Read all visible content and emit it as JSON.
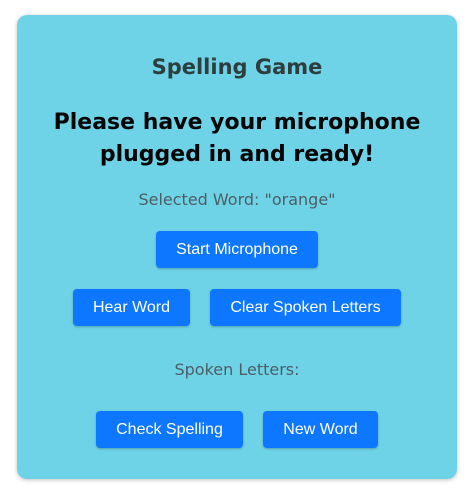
{
  "game": {
    "title": "Spelling Game",
    "instruction": "Please have your microphone plugged in and ready!",
    "selected_word_text": "Selected Word: \"orange\"",
    "spoken_letters_label": "Spoken Letters:"
  },
  "buttons": {
    "start_microphone": "Start Microphone",
    "hear_word": "Hear Word",
    "clear_spoken_letters": "Clear Spoken Letters",
    "check_spelling": "Check Spelling",
    "new_word": "New Word"
  },
  "colors": {
    "card_background": "#6fd3e7",
    "button_primary": "#0d78ff",
    "title_text": "#2e3d3d",
    "muted_text": "#4c5e64"
  }
}
